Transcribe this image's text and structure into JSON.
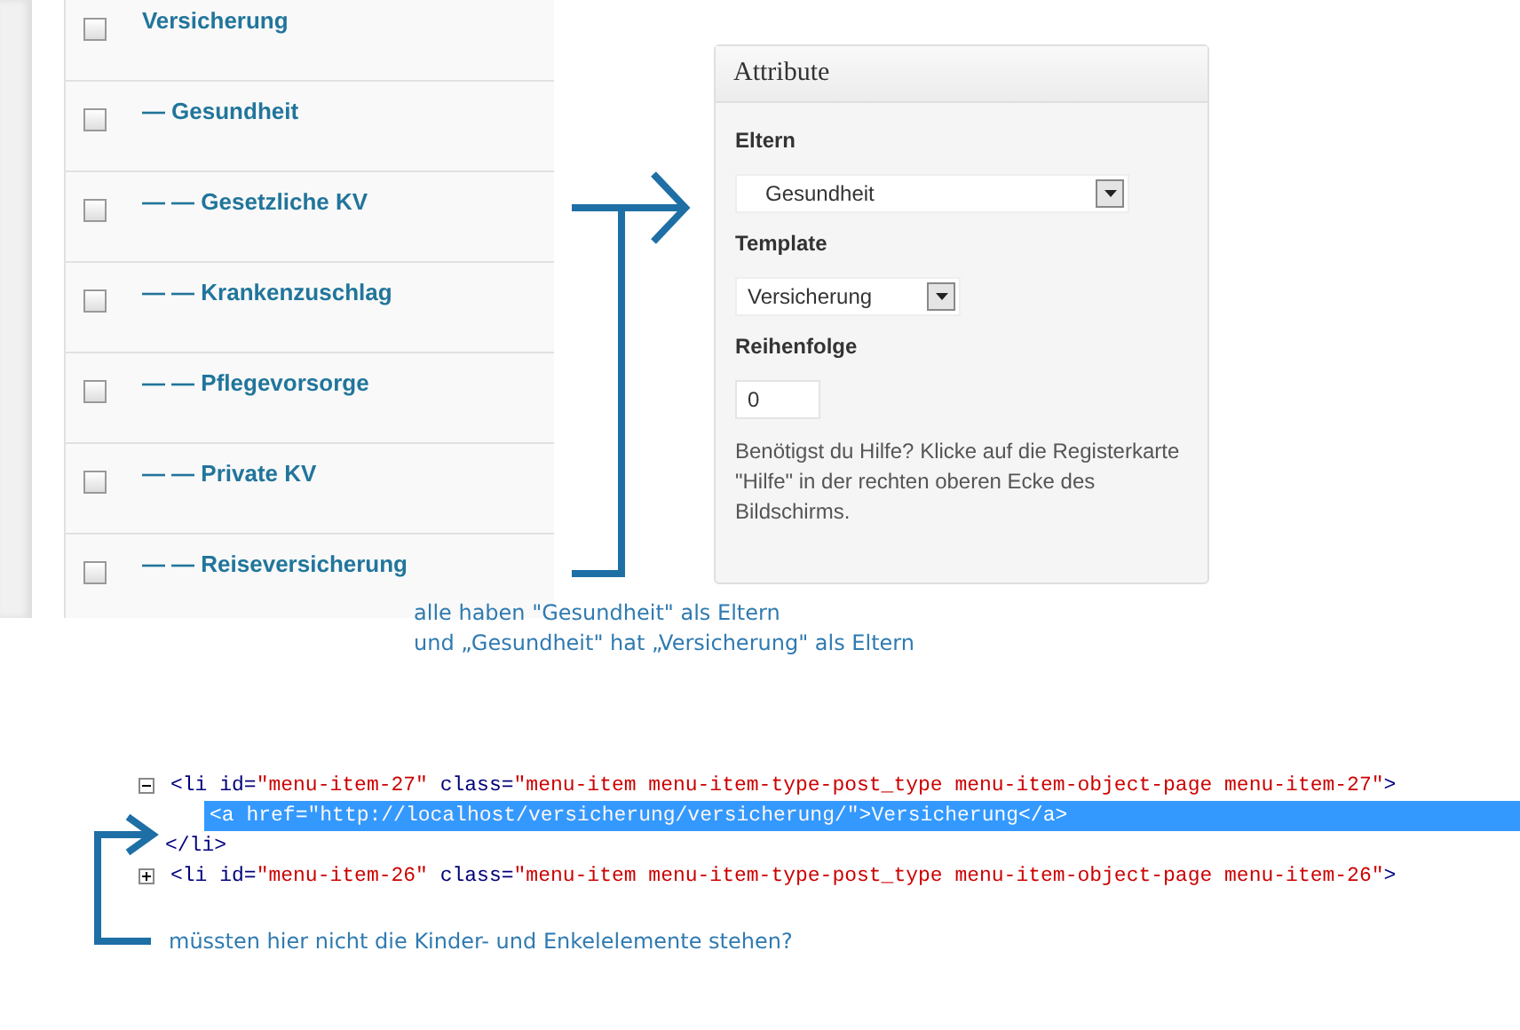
{
  "pages": [
    {
      "title": "Versicherung",
      "checked": false
    },
    {
      "title": "— Gesundheit",
      "checked": false
    },
    {
      "title": "— — Gesetzliche KV",
      "checked": false
    },
    {
      "title": "— — Krankenzuschlag",
      "checked": false
    },
    {
      "title": "— — Pflegevorsorge",
      "checked": false
    },
    {
      "title": "— — Private KV",
      "checked": false
    },
    {
      "title": "— — Reiseversicherung",
      "checked": false
    }
  ],
  "attributes": {
    "title": "Attribute",
    "fields": [
      {
        "kind": "select",
        "label": "Eltern",
        "value": "Gesundheit"
      },
      {
        "kind": "select",
        "label": "Template",
        "value": "Versicherung"
      },
      {
        "kind": "number",
        "label": "Reihenfolge",
        "value": "0"
      }
    ],
    "help": "Benötigst du Hilfe? Klicke auf die Registerkarte \"Hilfe\" in der rechten oberen Ecke des Bildschirms."
  },
  "note_top": [
    "alle haben \"Gesundheit\" als Eltern",
    "und „Gesundheit\" hat „Versicherung\" als Eltern"
  ],
  "code_tree": [
    {
      "expanded": true,
      "selected": false,
      "segments": [
        {
          "kind": "tag",
          "text": "<li "
        },
        {
          "kind": "attr",
          "text": "id="
        },
        {
          "kind": "value",
          "text": "\"menu-item-27\""
        },
        {
          "kind": "attr",
          "text": " class="
        },
        {
          "kind": "value",
          "text": "\"menu-item menu-item-type-post_type menu-item-object-page menu-item-27\""
        },
        {
          "kind": "tag",
          "text": ">"
        }
      ],
      "children": [
        {
          "selected": true,
          "segments": [
            {
              "kind": "tag",
              "text": "<a "
            },
            {
              "kind": "attr",
              "text": "href="
            },
            {
              "kind": "value",
              "text": "\"http://localhost/versicherung/versicherung/\""
            },
            {
              "kind": "tag",
              "text": ">"
            },
            {
              "kind": "text",
              "text": "Versicherung"
            },
            {
              "kind": "tag",
              "text": "</a>"
            }
          ]
        }
      ],
      "close": [
        {
          "kind": "tag",
          "text": "</li>"
        }
      ]
    },
    {
      "expanded": false,
      "selected": false,
      "segments": [
        {
          "kind": "tag",
          "text": "<li "
        },
        {
          "kind": "attr",
          "text": "id="
        },
        {
          "kind": "value",
          "text": "\"menu-item-26\""
        },
        {
          "kind": "attr",
          "text": " class="
        },
        {
          "kind": "value",
          "text": "\"menu-item menu-item-type-post_type menu-item-object-page menu-item-26\""
        },
        {
          "kind": "tag",
          "text": ">"
        }
      ]
    }
  ],
  "note_bottom": "müssten hier nicht die Kinder- und Enkelelemente stehen?"
}
